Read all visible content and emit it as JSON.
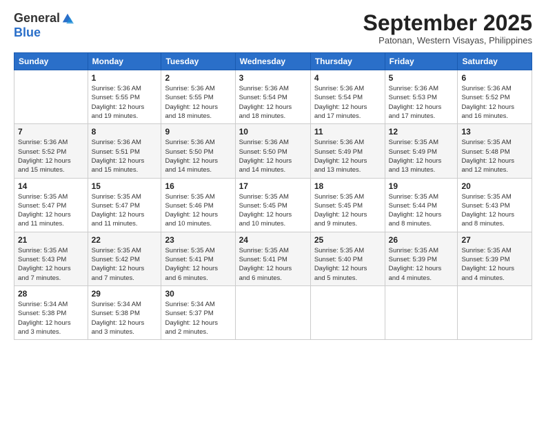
{
  "logo": {
    "general": "General",
    "blue": "Blue"
  },
  "title": "September 2025",
  "location": "Patonan, Western Visayas, Philippines",
  "days_of_week": [
    "Sunday",
    "Monday",
    "Tuesday",
    "Wednesday",
    "Thursday",
    "Friday",
    "Saturday"
  ],
  "weeks": [
    [
      {
        "day": "",
        "info": ""
      },
      {
        "day": "1",
        "info": "Sunrise: 5:36 AM\nSunset: 5:55 PM\nDaylight: 12 hours\nand 19 minutes."
      },
      {
        "day": "2",
        "info": "Sunrise: 5:36 AM\nSunset: 5:55 PM\nDaylight: 12 hours\nand 18 minutes."
      },
      {
        "day": "3",
        "info": "Sunrise: 5:36 AM\nSunset: 5:54 PM\nDaylight: 12 hours\nand 18 minutes."
      },
      {
        "day": "4",
        "info": "Sunrise: 5:36 AM\nSunset: 5:54 PM\nDaylight: 12 hours\nand 17 minutes."
      },
      {
        "day": "5",
        "info": "Sunrise: 5:36 AM\nSunset: 5:53 PM\nDaylight: 12 hours\nand 17 minutes."
      },
      {
        "day": "6",
        "info": "Sunrise: 5:36 AM\nSunset: 5:52 PM\nDaylight: 12 hours\nand 16 minutes."
      }
    ],
    [
      {
        "day": "7",
        "info": "Sunrise: 5:36 AM\nSunset: 5:52 PM\nDaylight: 12 hours\nand 15 minutes."
      },
      {
        "day": "8",
        "info": "Sunrise: 5:36 AM\nSunset: 5:51 PM\nDaylight: 12 hours\nand 15 minutes."
      },
      {
        "day": "9",
        "info": "Sunrise: 5:36 AM\nSunset: 5:50 PM\nDaylight: 12 hours\nand 14 minutes."
      },
      {
        "day": "10",
        "info": "Sunrise: 5:36 AM\nSunset: 5:50 PM\nDaylight: 12 hours\nand 14 minutes."
      },
      {
        "day": "11",
        "info": "Sunrise: 5:36 AM\nSunset: 5:49 PM\nDaylight: 12 hours\nand 13 minutes."
      },
      {
        "day": "12",
        "info": "Sunrise: 5:35 AM\nSunset: 5:49 PM\nDaylight: 12 hours\nand 13 minutes."
      },
      {
        "day": "13",
        "info": "Sunrise: 5:35 AM\nSunset: 5:48 PM\nDaylight: 12 hours\nand 12 minutes."
      }
    ],
    [
      {
        "day": "14",
        "info": "Sunrise: 5:35 AM\nSunset: 5:47 PM\nDaylight: 12 hours\nand 11 minutes."
      },
      {
        "day": "15",
        "info": "Sunrise: 5:35 AM\nSunset: 5:47 PM\nDaylight: 12 hours\nand 11 minutes."
      },
      {
        "day": "16",
        "info": "Sunrise: 5:35 AM\nSunset: 5:46 PM\nDaylight: 12 hours\nand 10 minutes."
      },
      {
        "day": "17",
        "info": "Sunrise: 5:35 AM\nSunset: 5:45 PM\nDaylight: 12 hours\nand 10 minutes."
      },
      {
        "day": "18",
        "info": "Sunrise: 5:35 AM\nSunset: 5:45 PM\nDaylight: 12 hours\nand 9 minutes."
      },
      {
        "day": "19",
        "info": "Sunrise: 5:35 AM\nSunset: 5:44 PM\nDaylight: 12 hours\nand 8 minutes."
      },
      {
        "day": "20",
        "info": "Sunrise: 5:35 AM\nSunset: 5:43 PM\nDaylight: 12 hours\nand 8 minutes."
      }
    ],
    [
      {
        "day": "21",
        "info": "Sunrise: 5:35 AM\nSunset: 5:43 PM\nDaylight: 12 hours\nand 7 minutes."
      },
      {
        "day": "22",
        "info": "Sunrise: 5:35 AM\nSunset: 5:42 PM\nDaylight: 12 hours\nand 7 minutes."
      },
      {
        "day": "23",
        "info": "Sunrise: 5:35 AM\nSunset: 5:41 PM\nDaylight: 12 hours\nand 6 minutes."
      },
      {
        "day": "24",
        "info": "Sunrise: 5:35 AM\nSunset: 5:41 PM\nDaylight: 12 hours\nand 6 minutes."
      },
      {
        "day": "25",
        "info": "Sunrise: 5:35 AM\nSunset: 5:40 PM\nDaylight: 12 hours\nand 5 minutes."
      },
      {
        "day": "26",
        "info": "Sunrise: 5:35 AM\nSunset: 5:39 PM\nDaylight: 12 hours\nand 4 minutes."
      },
      {
        "day": "27",
        "info": "Sunrise: 5:35 AM\nSunset: 5:39 PM\nDaylight: 12 hours\nand 4 minutes."
      }
    ],
    [
      {
        "day": "28",
        "info": "Sunrise: 5:34 AM\nSunset: 5:38 PM\nDaylight: 12 hours\nand 3 minutes."
      },
      {
        "day": "29",
        "info": "Sunrise: 5:34 AM\nSunset: 5:38 PM\nDaylight: 12 hours\nand 3 minutes."
      },
      {
        "day": "30",
        "info": "Sunrise: 5:34 AM\nSunset: 5:37 PM\nDaylight: 12 hours\nand 2 minutes."
      },
      {
        "day": "",
        "info": ""
      },
      {
        "day": "",
        "info": ""
      },
      {
        "day": "",
        "info": ""
      },
      {
        "day": "",
        "info": ""
      }
    ]
  ]
}
